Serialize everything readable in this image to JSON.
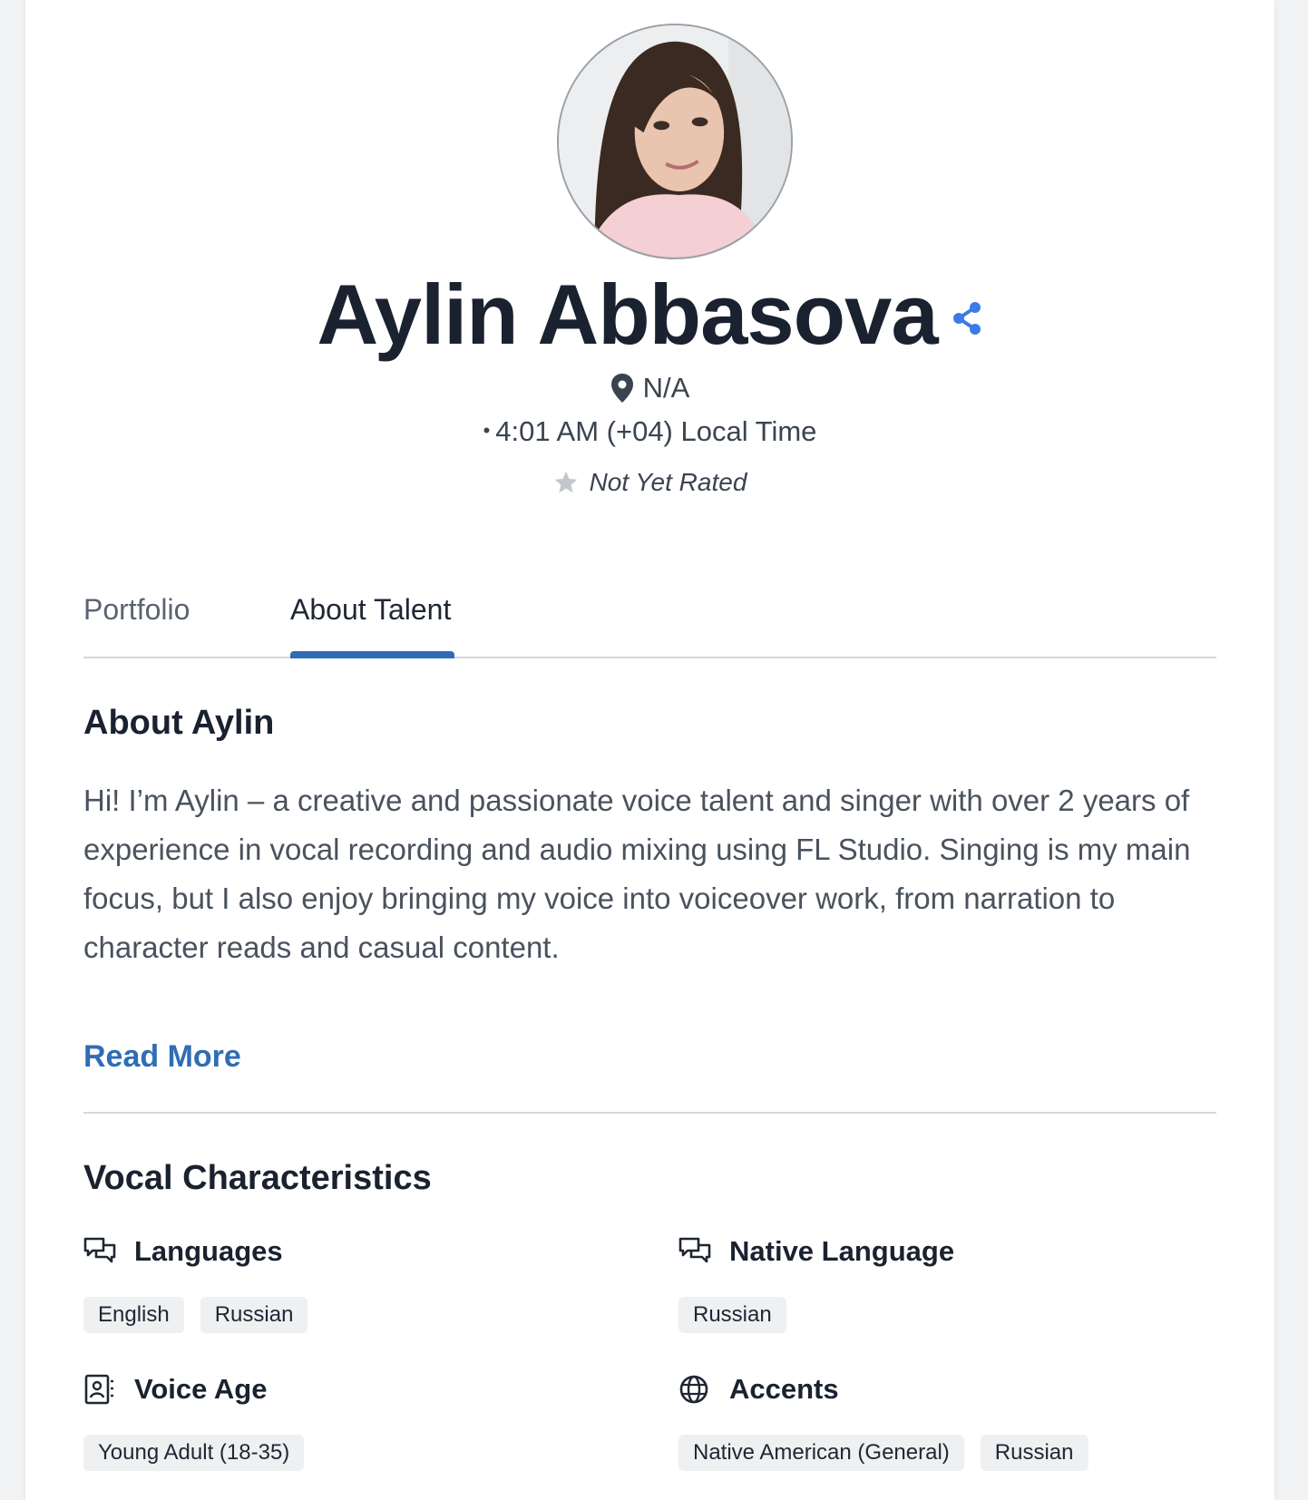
{
  "profile": {
    "name": "Aylin Abbasova",
    "location": "N/A",
    "local_time": "4:01 AM (+04) Local Time",
    "rating": "Not Yet Rated"
  },
  "tabs": [
    {
      "label": "Portfolio",
      "active": false
    },
    {
      "label": "About Talent",
      "active": true
    }
  ],
  "about": {
    "title": "About Aylin",
    "text": "Hi! I’m Aylin – a creative and passionate voice talent and singer with over 2 years of experience in vocal recording and audio mixing using FL Studio. Singing is my main focus, but I also enjoy bringing my voice into voiceover work, from narration to character reads and casual content.",
    "read_more": "Read More"
  },
  "vocal": {
    "title": "Vocal Characteristics",
    "languages": {
      "label": "Languages",
      "values": [
        "English",
        "Russian"
      ]
    },
    "native_language": {
      "label": "Native Language",
      "values": [
        "Russian"
      ]
    },
    "voice_age": {
      "label": "Voice Age",
      "values": [
        "Young Adult (18-35)"
      ]
    },
    "accents": {
      "label": "Accents",
      "values": [
        "Native American (General)",
        "Russian"
      ]
    }
  },
  "colors": {
    "accent": "#2f6db5",
    "share_icon": "#3b7be6",
    "chip_bg": "#eef0f2"
  },
  "icons": [
    "share-icon",
    "map-pin-icon",
    "star-icon",
    "chat-icon",
    "id-card-icon",
    "globe-icon"
  ]
}
